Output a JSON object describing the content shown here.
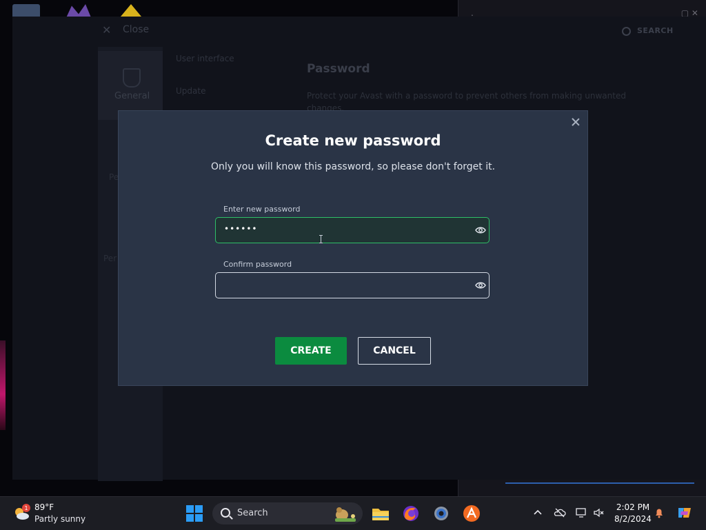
{
  "dialog": {
    "title": "Create new password",
    "subtitle": "Only you will know this password, so please don't forget it.",
    "new_password_label": "Enter new password",
    "new_password_value": "••••••",
    "confirm_password_label": "Confirm password",
    "confirm_password_value": "",
    "create_label": "CREATE",
    "cancel_label": "CANCEL"
  },
  "background_app": {
    "close_label": "Close",
    "search_label": "SEARCH",
    "nav_general": "General",
    "menu_items": [
      "User interface",
      "Update"
    ],
    "section_title": "Password",
    "section_text": "Protect your Avast with a password to prevent others from making unwanted changes.",
    "side_p1": "Pe",
    "side_p2": "Per"
  },
  "taskbar": {
    "weather_temp": "89°F",
    "weather_desc": "Partly sunny",
    "weather_badge": "1",
    "search_label": "Search",
    "clock_time": "2:02 PM",
    "clock_date": "8/2/2024"
  },
  "colors": {
    "accent_green": "#0b8b3f",
    "focus_border": "#2fbf67",
    "modal_bg": "#2a3446",
    "avast_orange": "#f26a21"
  }
}
